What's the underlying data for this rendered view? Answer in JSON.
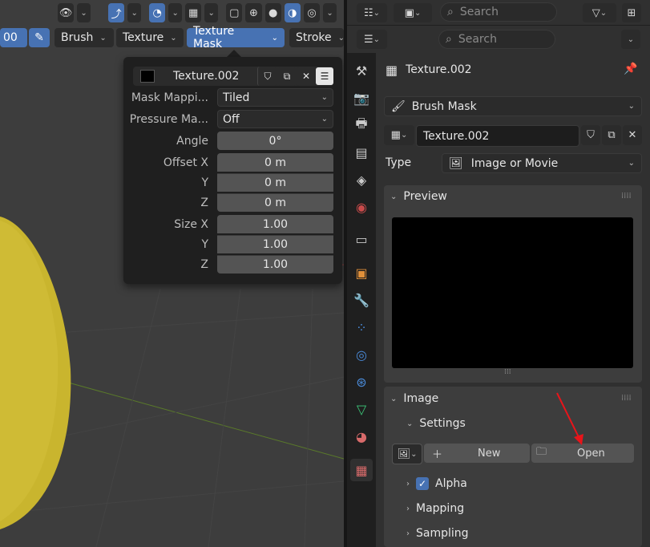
{
  "viewport_header": {
    "left_value": "00",
    "brush_label": "Brush",
    "texture_label": "Texture",
    "texture_mask_label": "Texture Mask",
    "stroke_label": "Stroke"
  },
  "popover": {
    "texture_name": "Texture.002",
    "mask_mapping_label": "Mask Mappi...",
    "mask_mapping_value": "Tiled",
    "pressure_label": "Pressure Ma...",
    "pressure_value": "Off",
    "angle_label": "Angle",
    "angle_value": "0°",
    "offset_x_label": "Offset X",
    "offset_x_value": "0 m",
    "offset_y_label": "Y",
    "offset_y_value": "0 m",
    "offset_z_label": "Z",
    "offset_z_value": "0 m",
    "size_x_label": "Size X",
    "size_x_value": "1.00",
    "size_y_label": "Y",
    "size_y_value": "1.00",
    "size_z_label": "Z",
    "size_z_value": "1.00"
  },
  "properties": {
    "search_placeholder_top": "Search",
    "search_placeholder": "Search",
    "context_texture": "Texture.002",
    "brush_mask_dropdown": "Brush Mask",
    "texture_field": "Texture.002",
    "type_label": "Type",
    "type_value": "Image or Movie",
    "preview_label": "Preview",
    "image_label": "Image",
    "settings_label": "Settings",
    "new_label": "New",
    "open_label": "Open",
    "alpha_label": "Alpha",
    "mapping_label": "Mapping",
    "sampling_label": "Sampling"
  },
  "colors": {
    "accent": "#4772b3",
    "sphere": "#c9b52e",
    "annotation_arrow": "#e8141a"
  }
}
